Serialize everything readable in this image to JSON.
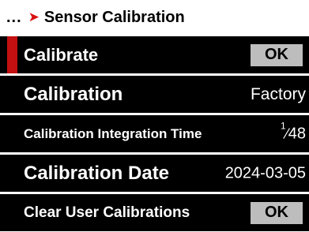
{
  "header": {
    "dots": "...",
    "arrow_icon": "chevron-right-icon",
    "title": "Sensor Calibration"
  },
  "rows": [
    {
      "label": "Calibrate",
      "button": "OK",
      "selected": true
    },
    {
      "label": "Calibration",
      "value": "Factory"
    },
    {
      "label": "Calibration Integration Time",
      "value_num": "1",
      "value_den": "48"
    },
    {
      "label": "Calibration Date",
      "value": "2024-03-05"
    },
    {
      "label": "Clear User Calibrations",
      "button": "OK"
    }
  ],
  "colors": {
    "accent": "#c41010",
    "row_bg": "#000000",
    "button_bg": "#bdbdbd"
  }
}
